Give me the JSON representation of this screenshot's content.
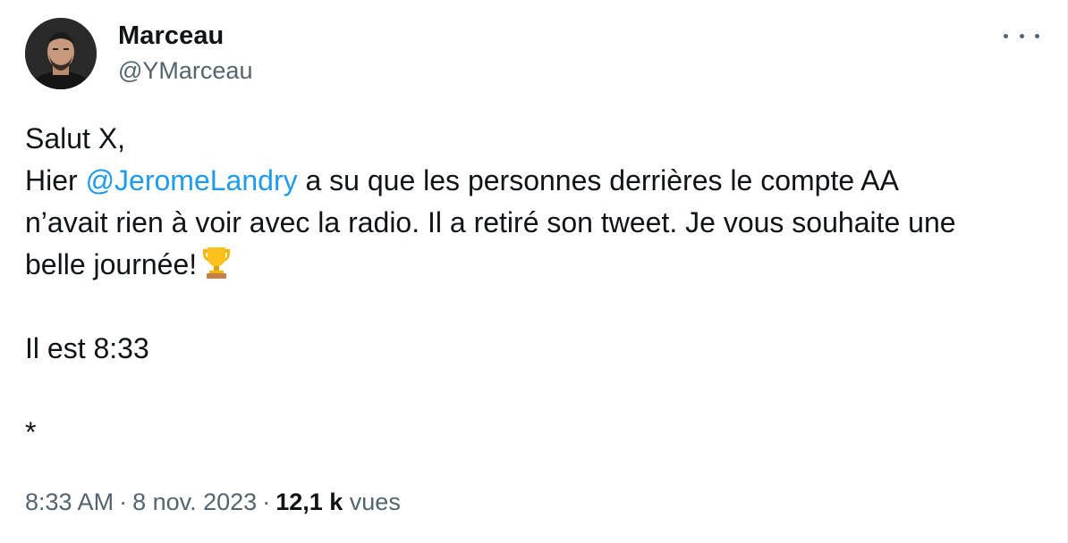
{
  "author": {
    "name": "Marceau",
    "handle": "@YMarceau"
  },
  "tweet": {
    "line1": "Salut X,",
    "line2_prefix": "Hier ",
    "mention": "@JeromeLandry",
    "line2_suffix": " a su que les personnes derrières le compte AA",
    "line3": "n’avait rien à voir avec la radio. Il a retiré son tweet. Je vous souhaite une",
    "line4": "belle journée!",
    "emoji": "trophy-icon",
    "line5": "Il est 8:33",
    "line6": "*"
  },
  "meta": {
    "time": "8:33 AM",
    "date": "8 nov. 2023",
    "separator": "·",
    "views_count": "12,1 k",
    "views_label": "vues"
  },
  "colors": {
    "text": "#0f1419",
    "secondary": "#536471",
    "link": "#1d9bf0"
  }
}
